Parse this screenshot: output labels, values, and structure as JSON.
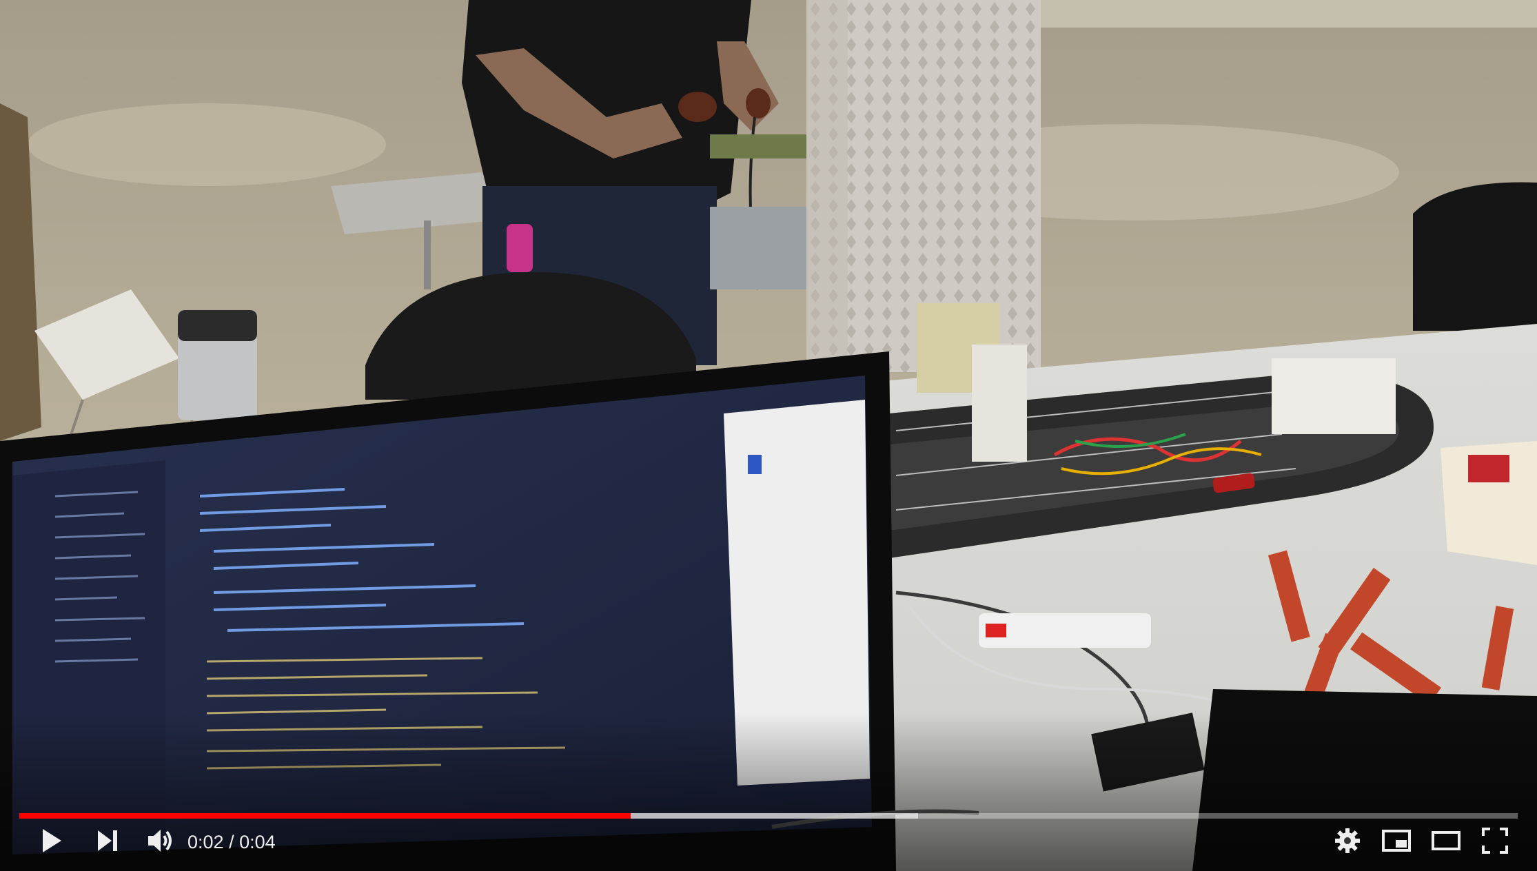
{
  "player": {
    "time_current": "0:02",
    "time_separator": " / ",
    "time_duration": "0:04",
    "progress_fraction": 0.408,
    "buffer_fraction": 0.6,
    "accent_color": "#ff0000"
  },
  "controls": {
    "play_icon": "play-icon",
    "next_icon": "next-icon",
    "volume_icon": "volume-icon",
    "settings_icon": "gear-icon",
    "miniplayer_icon": "miniplayer-icon",
    "theater_icon": "theater-mode-icon",
    "fullscreen_icon": "fullscreen-icon"
  }
}
